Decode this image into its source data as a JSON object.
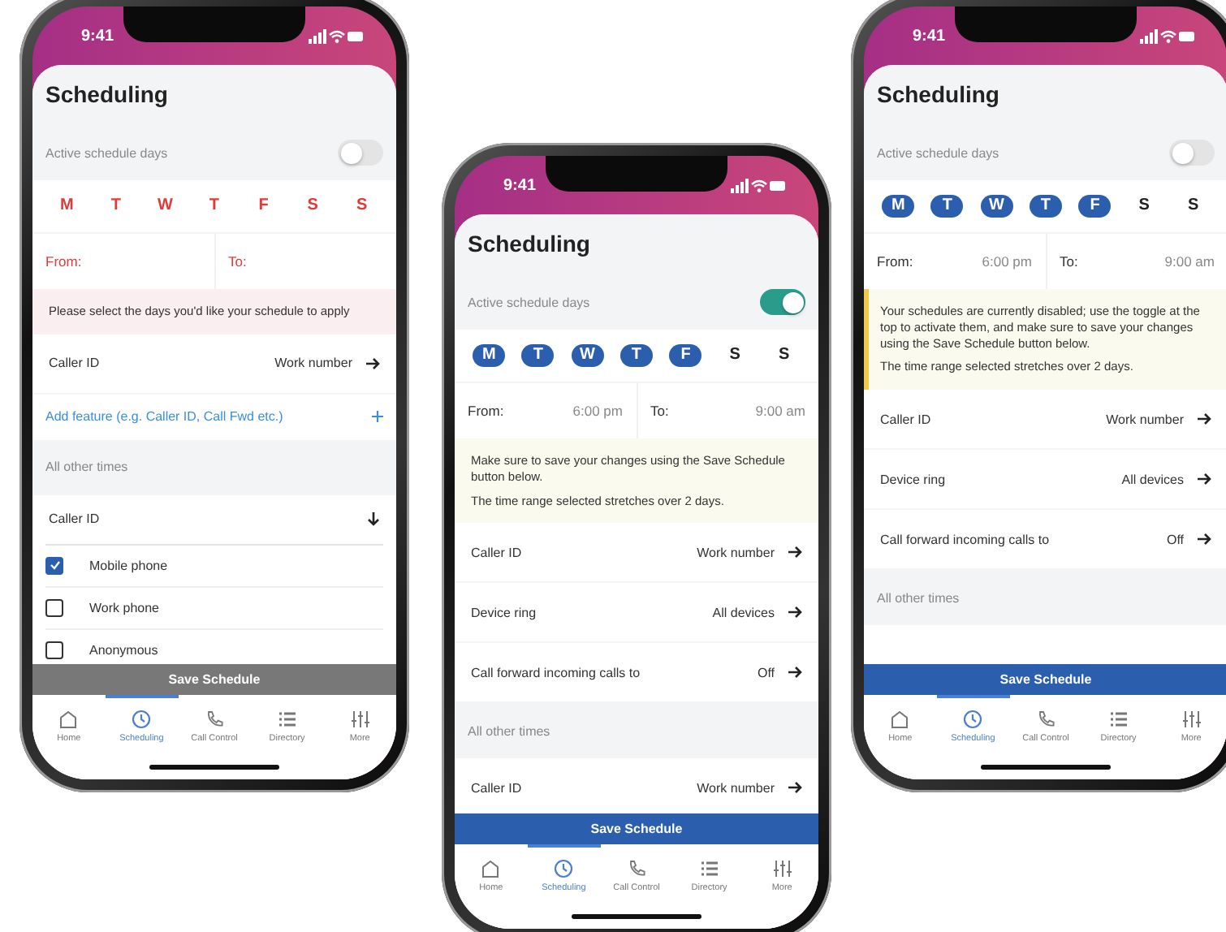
{
  "phones": [
    {
      "time": "9:41",
      "title": "Scheduling",
      "toggle_label": "Active schedule days",
      "toggle_on": false,
      "error": true,
      "days": [
        {
          "letter": "M",
          "selected": false
        },
        {
          "letter": "T",
          "selected": false
        },
        {
          "letter": "W",
          "selected": false
        },
        {
          "letter": "T",
          "selected": false
        },
        {
          "letter": "F",
          "selected": false
        },
        {
          "letter": "S",
          "selected": false
        },
        {
          "letter": "S",
          "selected": false
        }
      ],
      "from_label": "From:",
      "to_label": "To:",
      "notice": {
        "kind": "error",
        "paragraphs": [
          "Please select the days you'd like your schedule to apply"
        ]
      },
      "features": [
        {
          "label": "Caller ID",
          "value": "Work number"
        }
      ],
      "add_feature": "Add feature (e.g. Caller ID, Call Fwd etc.)",
      "section_label": "All other times",
      "other_times": [
        {
          "kind": "dropdown",
          "label": "Caller ID"
        },
        {
          "kind": "option",
          "label": "Mobile phone",
          "checked": true
        },
        {
          "kind": "option",
          "label": "Work phone",
          "checked": false
        },
        {
          "kind": "option",
          "label": "Anonymous",
          "checked": false
        }
      ],
      "save_label": "Save Schedule",
      "save_disabled": true,
      "tabs": [
        {
          "label": "Home",
          "selected": false
        },
        {
          "label": "Scheduling",
          "selected": true
        },
        {
          "label": "Call Control",
          "selected": false
        },
        {
          "label": "Directory",
          "selected": false
        },
        {
          "label": "More",
          "selected": false
        }
      ]
    },
    {
      "time": "9:41",
      "title": "Scheduling",
      "toggle_label": "Active schedule days",
      "toggle_on": true,
      "error": false,
      "days": [
        {
          "letter": "M",
          "selected": true
        },
        {
          "letter": "T",
          "selected": true
        },
        {
          "letter": "W",
          "selected": true
        },
        {
          "letter": "T",
          "selected": true
        },
        {
          "letter": "F",
          "selected": true
        },
        {
          "letter": "S",
          "selected": false
        },
        {
          "letter": "S",
          "selected": false
        }
      ],
      "from_label": "From:",
      "from_value": "6:00 pm",
      "to_label": "To:",
      "to_value": "9:00 am",
      "notice": {
        "kind": "info",
        "paragraphs": [
          "Make sure to save your changes using the Save Schedule button below.",
          "The time range selected stretches over 2 days."
        ]
      },
      "features": [
        {
          "label": "Caller ID",
          "value": "Work number"
        },
        {
          "label": "Device ring",
          "value": "All devices"
        },
        {
          "label": "Call forward incoming calls to",
          "value": "Off"
        }
      ],
      "section_label": "All other times",
      "other_times": [
        {
          "kind": "row",
          "label": "Caller ID",
          "value": "Work number"
        }
      ],
      "save_label": "Save Schedule",
      "save_disabled": false,
      "tabs": [
        {
          "label": "Home",
          "selected": false
        },
        {
          "label": "Scheduling",
          "selected": true
        },
        {
          "label": "Call Control",
          "selected": false
        },
        {
          "label": "Directory",
          "selected": false
        },
        {
          "label": "More",
          "selected": false
        }
      ]
    },
    {
      "time": "9:41",
      "title": "Scheduling",
      "toggle_label": "Active schedule days",
      "toggle_on": false,
      "error": false,
      "days": [
        {
          "letter": "M",
          "selected": true
        },
        {
          "letter": "T",
          "selected": true
        },
        {
          "letter": "W",
          "selected": true
        },
        {
          "letter": "T",
          "selected": true
        },
        {
          "letter": "F",
          "selected": true
        },
        {
          "letter": "S",
          "selected": false
        },
        {
          "letter": "S",
          "selected": false
        }
      ],
      "from_label": "From:",
      "from_value": "6:00 pm",
      "to_label": "To:",
      "to_value": "9:00 am",
      "notice": {
        "kind": "warning",
        "paragraphs": [
          "Your schedules are currently disabled; use the toggle at the top to activate them, and make sure to save your changes using the Save Schedule button below.",
          "The time range selected stretches over 2 days."
        ]
      },
      "features": [
        {
          "label": "Caller ID",
          "value": "Work number"
        },
        {
          "label": "Device ring",
          "value": "All devices"
        },
        {
          "label": "Call forward incoming calls to",
          "value": "Off"
        }
      ],
      "section_label": "All other times",
      "save_label": "Save Schedule",
      "save_disabled": false,
      "tabs": [
        {
          "label": "Home",
          "selected": false
        },
        {
          "label": "Scheduling",
          "selected": true
        },
        {
          "label": "Call Control",
          "selected": false
        },
        {
          "label": "Directory",
          "selected": false
        },
        {
          "label": "More",
          "selected": false
        }
      ]
    }
  ]
}
